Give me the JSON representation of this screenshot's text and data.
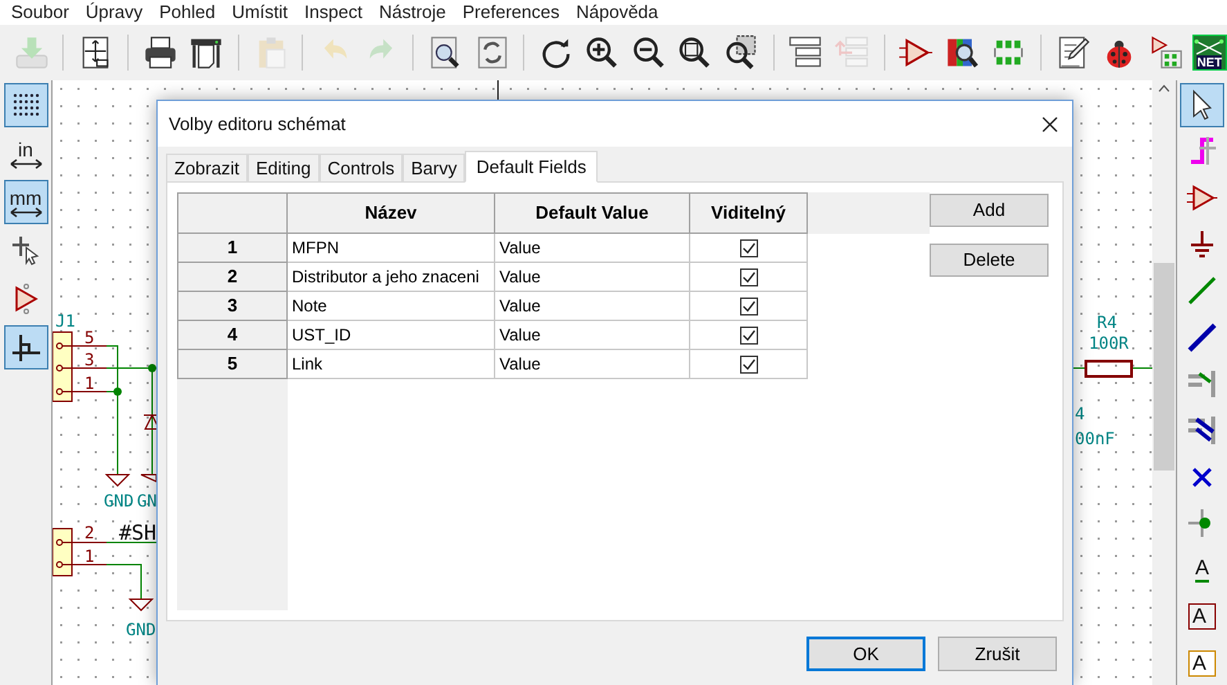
{
  "menu": [
    "Soubor",
    "Úpravy",
    "Pohled",
    "Umístit",
    "Inspect",
    "Nástroje",
    "Preferences",
    "Nápověda"
  ],
  "toolbar": {
    "groups": [
      [
        {
          "disabled": true
        }
      ],
      [
        {
          "disabled": false
        }
      ],
      [
        {
          "disabled": false
        },
        {
          "disabled": false
        }
      ],
      [
        {
          "disabled": true
        }
      ],
      [
        {
          "disabled": true
        },
        {
          "disabled": true
        }
      ],
      [
        {
          "disabled": false
        },
        {
          "disabled": false
        }
      ],
      [
        {
          "disabled": false
        },
        {
          "disabled": false
        },
        {
          "disabled": false
        },
        {
          "disabled": false
        },
        {
          "disabled": false
        }
      ],
      [
        {
          "disabled": false
        },
        {
          "disabled": true
        }
      ],
      [
        {
          "disabled": false
        },
        {
          "disabled": false
        },
        {
          "disabled": false
        }
      ],
      [
        {
          "disabled": false
        },
        {
          "disabled": false
        },
        {
          "disabled": false
        }
      ]
    ],
    "net_label": "NET"
  },
  "left_toolbar": [
    {
      "selected": true
    },
    {
      "selected": false,
      "label": "in"
    },
    {
      "selected": true,
      "label": "mm"
    },
    {
      "selected": false
    },
    {
      "selected": false
    },
    {
      "selected": true
    }
  ],
  "right_toolbar": [
    {
      "selected": true
    },
    {
      "selected": false
    },
    {
      "selected": false
    },
    {
      "selected": false
    },
    {
      "selected": false
    },
    {
      "selected": false
    },
    {
      "selected": false
    },
    {
      "selected": false
    },
    {
      "selected": false
    },
    {
      "selected": false
    },
    {
      "selected": false,
      "label": "A"
    },
    {
      "selected": false,
      "label": "A"
    },
    {
      "selected": false,
      "label": "A"
    }
  ],
  "schematic": {
    "texts": [
      {
        "kind": "ref",
        "text": "J1"
      },
      {
        "kind": "pin",
        "text": "5"
      },
      {
        "kind": "pin",
        "text": "3"
      },
      {
        "kind": "pin",
        "text": "1"
      },
      {
        "kind": "ref",
        "text": "GND"
      },
      {
        "kind": "ref",
        "text": "GN"
      },
      {
        "kind": "pin",
        "text": "2"
      },
      {
        "kind": "pin",
        "text": "1"
      },
      {
        "kind": "label",
        "text": "#SH"
      },
      {
        "kind": "ref",
        "text": "GND"
      },
      {
        "kind": "ref",
        "text": "R4"
      },
      {
        "kind": "ref",
        "text": "100R"
      },
      {
        "kind": "ref",
        "text": "4"
      },
      {
        "kind": "ref",
        "text": "00nF"
      }
    ]
  },
  "dialog": {
    "title": "Volby editoru schémat",
    "tabs": [
      {
        "label": "Zobrazit",
        "selected": false
      },
      {
        "label": "Editing",
        "selected": false
      },
      {
        "label": "Controls",
        "selected": false
      },
      {
        "label": "Barvy",
        "selected": false
      },
      {
        "label": "Default Fields",
        "selected": true
      }
    ],
    "table": {
      "columns": [
        "Název",
        "Default Value",
        "Viditelný"
      ],
      "rows": [
        {
          "number": "1",
          "name": "MFPN",
          "default_value": "Value",
          "visible": true
        },
        {
          "number": "2",
          "name": "Distributor a jeho znaceni",
          "default_value": "Value",
          "visible": true
        },
        {
          "number": "3",
          "name": "Note",
          "default_value": "Value",
          "visible": true
        },
        {
          "number": "4",
          "name": "UST_ID",
          "default_value": "Value",
          "visible": true
        },
        {
          "number": "5",
          "name": "Link",
          "default_value": "Value",
          "visible": true
        }
      ]
    },
    "side_buttons": [
      "Add",
      "Delete"
    ],
    "footer_buttons": [
      {
        "label": "OK",
        "default": true
      },
      {
        "label": "Zrušit",
        "default": false
      }
    ]
  }
}
